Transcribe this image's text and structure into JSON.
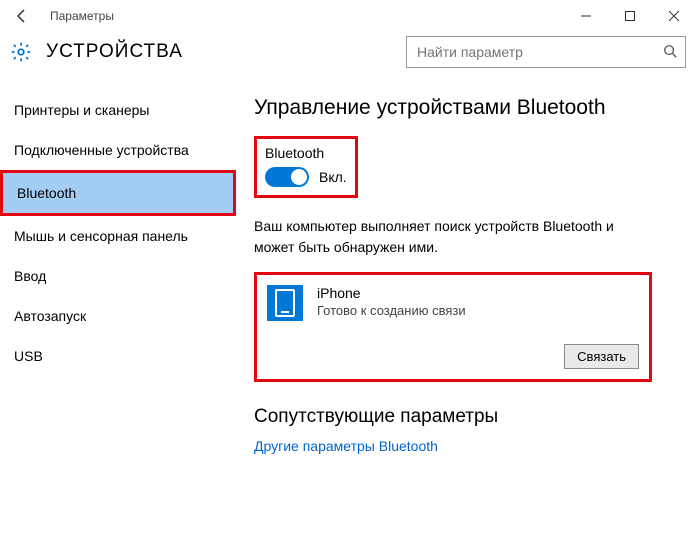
{
  "window": {
    "title": "Параметры"
  },
  "header": {
    "section": "УСТРОЙСТВА",
    "searchPlaceholder": "Найти параметр"
  },
  "sidebar": {
    "items": [
      {
        "label": "Принтеры и сканеры"
      },
      {
        "label": "Подключенные устройства"
      },
      {
        "label": "Bluetooth"
      },
      {
        "label": "Мышь и сенсорная панель"
      },
      {
        "label": "Ввод"
      },
      {
        "label": "Автозапуск"
      },
      {
        "label": "USB"
      }
    ]
  },
  "content": {
    "title": "Управление устройствами Bluetooth",
    "bluetoothLabel": "Bluetooth",
    "toggleState": "Вкл.",
    "description": "Ваш компьютер выполняет поиск устройств Bluetooth и может быть обнаружен ими.",
    "device": {
      "name": "iPhone",
      "status": "Готово к созданию связи",
      "pair": "Связать"
    },
    "relatedTitle": "Сопутствующие параметры",
    "relatedLink": "Другие параметры Bluetooth"
  }
}
